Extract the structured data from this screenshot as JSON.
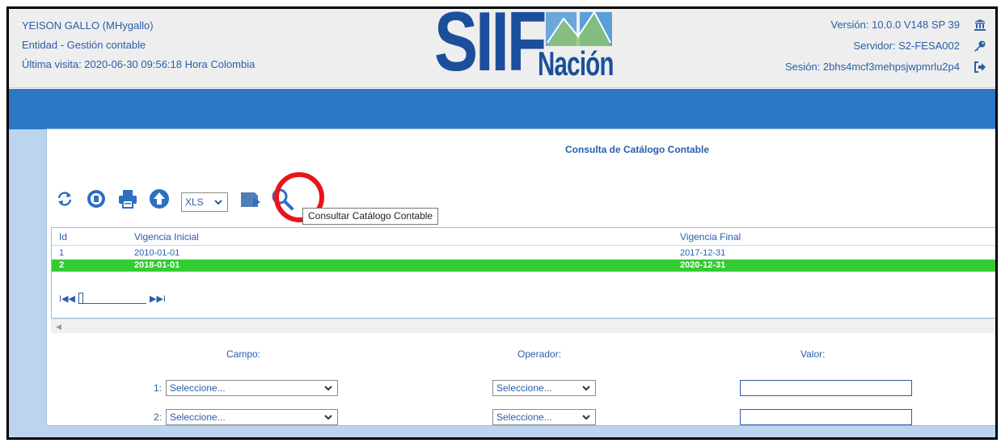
{
  "header": {
    "user": "YEISON GALLO (MHygallo)",
    "entity": "Entidad - Gestión contable",
    "last_visit": "Última visita: 2020-06-30 09:56:18 Hora Colombia",
    "version": "Versión: 10.0.0 V148 SP 39",
    "server": "Servidor: S2-FESA002",
    "session": "Sesión: 2bhs4mcf3mehpsjwpmrlu2p4",
    "logo_top": "SIIF",
    "logo_bottom": "Nación",
    "icons": [
      "bank-icon",
      "key-icon",
      "logout-icon"
    ]
  },
  "panel": {
    "title": "Consulta de Catálogo Contable"
  },
  "toolbar": {
    "icons": [
      "refresh-icon",
      "record-icon",
      "print-icon",
      "upload-icon",
      "export-icon",
      "search-icon"
    ],
    "format_selected": "XLS",
    "tooltip": "Consultar Catálogo Contable"
  },
  "grid": {
    "columns": [
      "Id",
      "Vigencia Inicial",
      "Vigencia Final"
    ],
    "rows": [
      {
        "id": "1",
        "start": "2010-01-01",
        "end": "2017-12-31",
        "selected": false
      },
      {
        "id": "2",
        "start": "2018-01-01",
        "end": "2020-12-31",
        "selected": true
      }
    ],
    "pager": {
      "first": "I◀◀",
      "last": "▶▶I"
    }
  },
  "filters": {
    "field_label": "Campo:",
    "operator_label": "Operador:",
    "value_label": "Valor:",
    "rows": [
      {
        "num": "1:",
        "field": "Seleccione...",
        "operator": "Seleccione...",
        "value": ""
      },
      {
        "num": "2:",
        "field": "Seleccione...",
        "operator": "Seleccione...",
        "value": ""
      }
    ]
  },
  "colors": {
    "accent_blue": "#2a5ea8",
    "band_blue": "#2d78c6",
    "selected_row": "#33cc33",
    "highlight_circle": "#e8141b"
  }
}
